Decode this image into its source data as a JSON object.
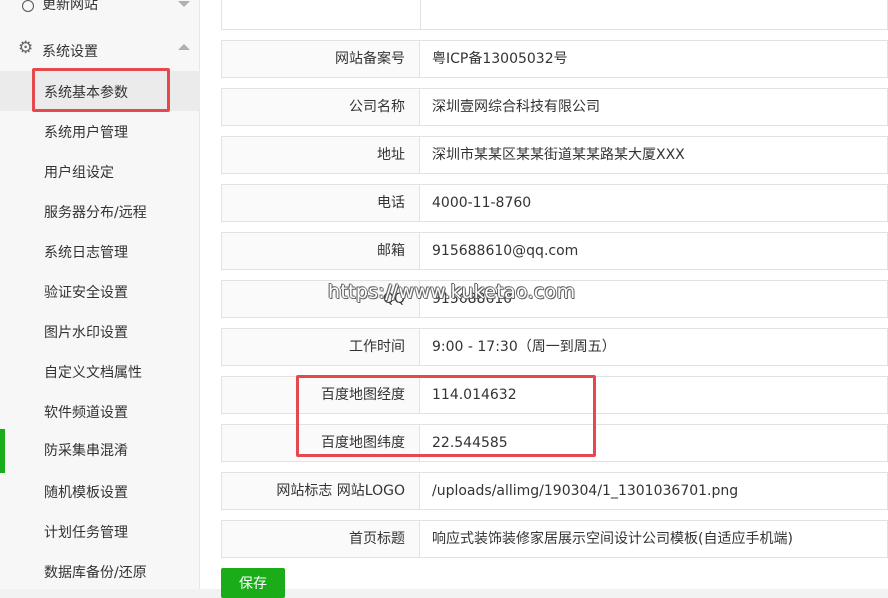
{
  "sidebar": {
    "prev_item": "更新网站",
    "group": {
      "label": "系统设置"
    },
    "items": [
      {
        "label": "系统基本参数"
      },
      {
        "label": "系统用户管理"
      },
      {
        "label": "用户组设定"
      },
      {
        "label": "服务器分布/远程"
      },
      {
        "label": "系统日志管理"
      },
      {
        "label": "验证安全设置"
      },
      {
        "label": "图片水印设置"
      },
      {
        "label": "自定义文档属性"
      },
      {
        "label": "软件频道设置"
      },
      {
        "label": "防采集串混淆"
      },
      {
        "label": "随机模板设置"
      },
      {
        "label": "计划任务管理"
      },
      {
        "label": "数据库备份/还原"
      }
    ]
  },
  "form": {
    "rows": [
      {
        "label": "网站备案号",
        "value": "粤ICP备13005032号"
      },
      {
        "label": "公司名称",
        "value": "深圳壹网综合科技有限公司"
      },
      {
        "label": "地址",
        "value": "深圳市某某区某某街道某某路某大厦XXX"
      },
      {
        "label": "电话",
        "value": "4000-11-8760"
      },
      {
        "label": "邮箱",
        "value": "915688610@qq.com"
      },
      {
        "label": "QQ",
        "value": "915688610"
      },
      {
        "label": "工作时间",
        "value": "9:00 - 17:30（周一到周五）"
      },
      {
        "label": "百度地图经度",
        "value": "114.014632"
      },
      {
        "label": "百度地图纬度",
        "value": "22.544585"
      },
      {
        "label": "网站标志 网站LOGO",
        "value": "/uploads/allimg/190304/1_1301036701.png"
      },
      {
        "label": "首页标题",
        "value": "响应式装饰装修家居展示空间设计公司模板(自适应手机端)"
      }
    ],
    "save_label": "保存"
  },
  "watermark": "https://www.kuketao.com",
  "colors": {
    "accent": "#1aad19",
    "highlight": "#e5484d"
  }
}
